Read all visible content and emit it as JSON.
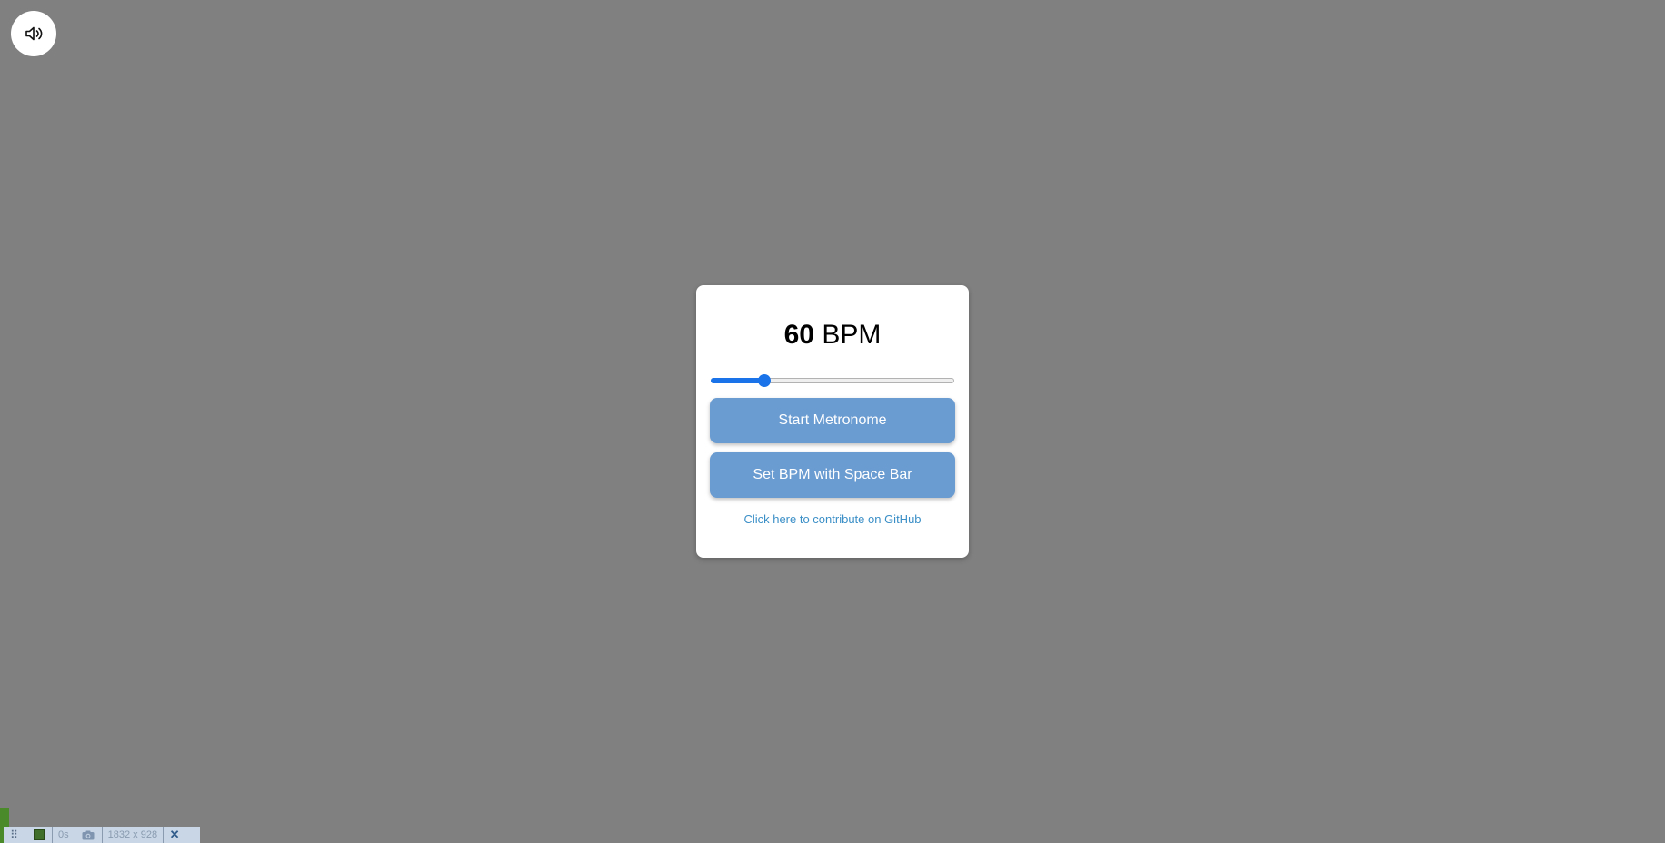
{
  "sound": {
    "icon": "speaker-icon"
  },
  "metronome": {
    "bpm_value": "60",
    "bpm_unit": "BPM",
    "slider_fraction": 0.22,
    "accent_color": "#1a73e8",
    "button_color": "#6a9bd1"
  },
  "buttons": {
    "start_label": "Start Metronome",
    "tap_label": "Set BPM with Space Bar"
  },
  "link": {
    "github_label": "Click here to contribute on GitHub"
  },
  "devbar": {
    "time": "0s",
    "size": "1832 x 928"
  }
}
